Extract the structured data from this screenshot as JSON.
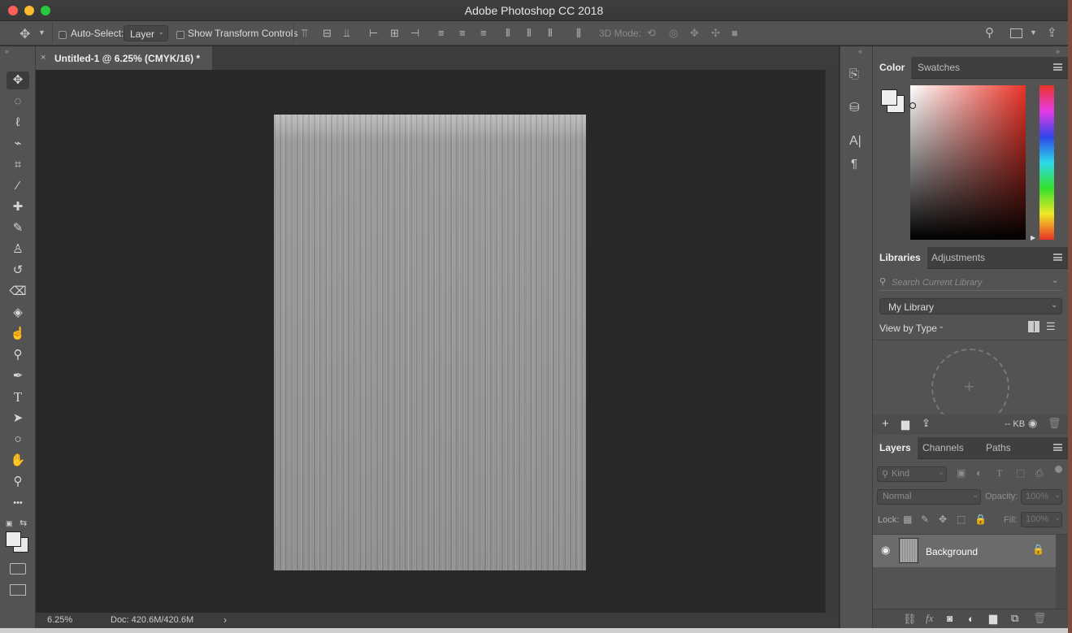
{
  "window": {
    "title": "Adobe Photoshop CC 2018"
  },
  "options_bar": {
    "auto_select_label": "Auto-Select:",
    "auto_select_value": "Layer",
    "show_transform_label": "Show Transform Controls",
    "mode_3d_label": "3D Mode:"
  },
  "document": {
    "tab_title": "Untitled-1 @ 6.25% (CMYK/16) *",
    "close_glyph": "×"
  },
  "status": {
    "zoom": "6.25%",
    "doc_size": "Doc: 420.6M/420.6M",
    "arrow": "›"
  },
  "tools": [
    {
      "name": "move-tool",
      "glyph": "✥"
    },
    {
      "name": "marquee-tool",
      "glyph": "◌"
    },
    {
      "name": "lasso-tool",
      "glyph": "ℓ"
    },
    {
      "name": "quick-selection-tool",
      "glyph": "⌁"
    },
    {
      "name": "crop-tool",
      "glyph": "⌗"
    },
    {
      "name": "eyedropper-tool",
      "glyph": "⁄"
    },
    {
      "name": "healing-brush-tool",
      "glyph": "✚"
    },
    {
      "name": "brush-tool",
      "glyph": "✎"
    },
    {
      "name": "clone-stamp-tool",
      "glyph": "♙"
    },
    {
      "name": "history-brush-tool",
      "glyph": "↺"
    },
    {
      "name": "eraser-tool",
      "glyph": "⌫"
    },
    {
      "name": "paint-bucket-tool",
      "glyph": "◈"
    },
    {
      "name": "smudge-tool",
      "glyph": "☝"
    },
    {
      "name": "dodge-tool",
      "glyph": "⚲"
    },
    {
      "name": "pen-tool",
      "glyph": "✒"
    },
    {
      "name": "type-tool",
      "glyph": "T"
    },
    {
      "name": "path-selection-tool",
      "glyph": "➤"
    },
    {
      "name": "ellipse-tool",
      "glyph": "○"
    },
    {
      "name": "hand-tool",
      "glyph": "✋"
    },
    {
      "name": "zoom-tool",
      "glyph": "⚲"
    },
    {
      "name": "more-tools",
      "glyph": "•••"
    }
  ],
  "color_panel": {
    "tab_color": "Color",
    "tab_swatches": "Swatches"
  },
  "libraries_panel": {
    "tab_libraries": "Libraries",
    "tab_adjustments": "Adjustments",
    "search_placeholder": "Search Current Library",
    "library_select": "My Library",
    "view_by": "View by Type",
    "size": "-- KB"
  },
  "layers_panel": {
    "tab_layers": "Layers",
    "tab_channels": "Channels",
    "tab_paths": "Paths",
    "kind_placeholder": "Kind",
    "blend_mode": "Normal",
    "opacity_label": "Opacity:",
    "opacity_value": "100%",
    "lock_label": "Lock:",
    "fill_label": "Fill:",
    "fill_value": "100%",
    "layer_name": "Background"
  },
  "colors": {
    "accent_red": "#e0443e",
    "panel": "#535353",
    "canvas_bg": "#282828"
  }
}
